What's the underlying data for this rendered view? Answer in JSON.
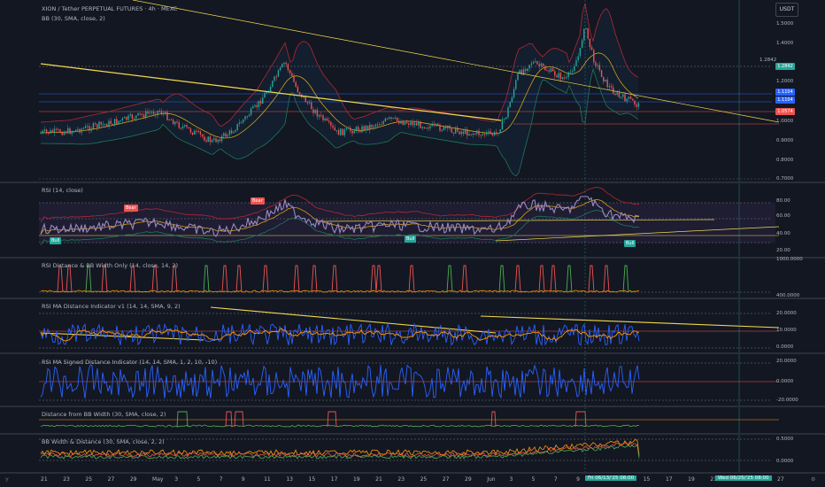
{
  "header": {
    "symbol_title": "XION / Tether PERPETUAL FUTURES · 4h · MEXC",
    "bb_indicator": "BB (30, SMA, close, 2)",
    "currency_button": "USDT"
  },
  "price_pane": {
    "axis": [
      "1.5000",
      "1.4000",
      "1.2000",
      "1.1000",
      "1.0000",
      "0.9000",
      "0.8000",
      "0.7000"
    ],
    "label_1284": "1.2842",
    "tag_green": "1.2842",
    "tag_blue": "1.1104",
    "tag_red": "1.0574"
  },
  "rsi_pane": {
    "title": "RSI (14, close)",
    "axis": [
      "80.00",
      "60.00",
      "40.00",
      "20.00"
    ],
    "markers": [
      {
        "label": "Bear"
      },
      {
        "label": "Bear"
      },
      {
        "label": "Bull"
      },
      {
        "label": "Bull"
      },
      {
        "label": "Bull"
      }
    ]
  },
  "rsi_dist_pane": {
    "title": "RSI Distance & BB Width Only (14, close, 14, 2)",
    "axis": [
      "1000.0000",
      "400.0000"
    ]
  },
  "rsi_ma_pane": {
    "title": "RSI MA Distance Indicator v1 (14, 14, SMA, 9, 2)",
    "axis": [
      "20.0000",
      "10.0000",
      "0.0000"
    ]
  },
  "rsi_signed_pane": {
    "title": "RSI MA Signed Distance Indicator (14, 14, SMA, 1, 2, 10, -10)",
    "axis": [
      "20.0000",
      "0.0000",
      "-20.0000"
    ]
  },
  "dist_bb_pane": {
    "title": "Distance from BB Width (30, SMA, close, 2)"
  },
  "bbw_pane": {
    "title": "BB Width & Distance (30, SMA, close, 2, 2)",
    "axis": [
      "0.5000",
      "0.0000"
    ]
  },
  "time_axis": {
    "labels": [
      "21",
      "23",
      "25",
      "27",
      "29",
      "May",
      "3",
      "5",
      "7",
      "9",
      "11",
      "13",
      "15",
      "17",
      "19",
      "21",
      "23",
      "25",
      "27",
      "29",
      "Jun",
      "3",
      "5",
      "7",
      "9",
      "11",
      "13",
      "15",
      "17",
      "19",
      "21",
      "23",
      "25",
      "27"
    ],
    "cursor_label": "Fri 06/13/'25   08:00",
    "end_label": "Wed 06/25/'25   08:00"
  },
  "controls": {
    "left": "Y",
    "right": "⚙"
  },
  "colors": {
    "bg": "#131722",
    "up": "#26a69a",
    "down": "#ef5350",
    "bb_upper": "#b22833",
    "bb_basis": "#d4a017",
    "bb_lower": "#1b7a5a",
    "rsi": "#9c88c4",
    "trend": "#f2d94e",
    "blue": "#2962ff",
    "orange": "#ff9800",
    "green_line": "#4caf50"
  }
}
